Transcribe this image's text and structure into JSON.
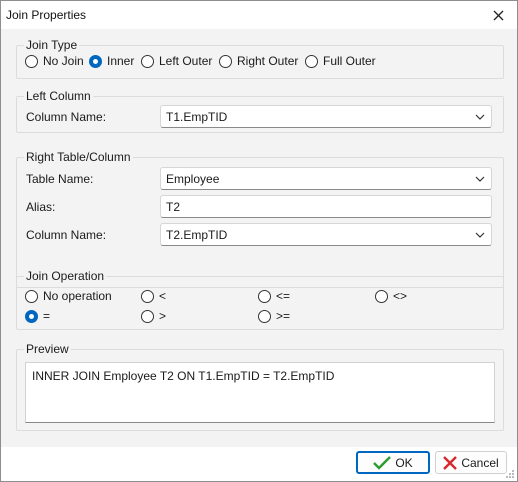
{
  "window": {
    "title": "Join Properties"
  },
  "join_type": {
    "legend": "Join Type",
    "options": [
      "No Join",
      "Inner",
      "Left Outer",
      "Right Outer",
      "Full Outer"
    ],
    "selected": "Inner"
  },
  "left_column": {
    "legend": "Left Column",
    "column_name_label": "Column Name:",
    "column_name_value": "T1.EmpTID"
  },
  "right_table": {
    "legend": "Right Table/Column",
    "table_name_label": "Table Name:",
    "table_name_value": "Employee",
    "alias_label": "Alias:",
    "alias_value": "T2",
    "column_name_label": "Column Name:",
    "column_name_value": "T2.EmpTID"
  },
  "join_operation": {
    "legend": "Join Operation",
    "options": [
      "No operation",
      "<",
      "<=",
      "<>",
      "=",
      ">",
      ">="
    ],
    "selected": "="
  },
  "preview": {
    "legend": "Preview",
    "text": "INNER JOIN Employee T2 ON T1.EmpTID = T2.EmpTID"
  },
  "buttons": {
    "ok": "OK",
    "cancel": "Cancel"
  },
  "colors": {
    "accent": "#0067c0",
    "ok_check": "#2e9b2e",
    "cancel_x": "#d8262b"
  }
}
